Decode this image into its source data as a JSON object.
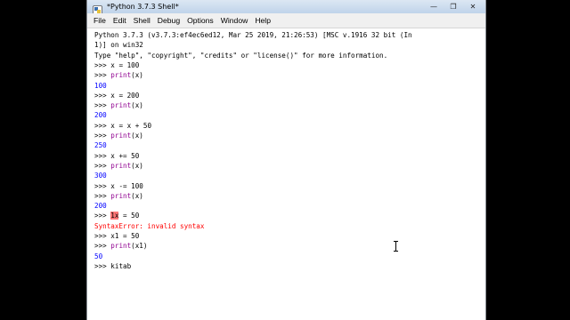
{
  "window": {
    "title": "*Python 3.7.3 Shell*",
    "min_glyph": "—",
    "max_glyph": "❐",
    "close_glyph": "✕"
  },
  "menu": [
    "File",
    "Edit",
    "Shell",
    "Debug",
    "Options",
    "Window",
    "Help"
  ],
  "banner": [
    "Python 3.7.3 (v3.7.3:ef4ec6ed12, Mar 25 2019, 21:26:53) [MSC v.1916 32 bit (In",
    "1)] on win32",
    "Type \"help\", \"copyright\", \"credits\" or \"license()\" for more information."
  ],
  "prompt": ">>> ",
  "session": [
    {
      "kind": "input",
      "text": "x = 100"
    },
    {
      "kind": "call",
      "fn": "print",
      "args": "(x)"
    },
    {
      "kind": "output",
      "text": "100"
    },
    {
      "kind": "input",
      "text": "x = 200"
    },
    {
      "kind": "call",
      "fn": "print",
      "args": "(x)"
    },
    {
      "kind": "output",
      "text": "200"
    },
    {
      "kind": "input",
      "text": "x = x + 50"
    },
    {
      "kind": "call",
      "fn": "print",
      "args": "(x)"
    },
    {
      "kind": "output",
      "text": "250"
    },
    {
      "kind": "input",
      "text": "x += 50"
    },
    {
      "kind": "call",
      "fn": "print",
      "args": "(x)"
    },
    {
      "kind": "output",
      "text": "300"
    },
    {
      "kind": "input",
      "text": "x -= 100"
    },
    {
      "kind": "call",
      "fn": "print",
      "args": "(x)"
    },
    {
      "kind": "output",
      "text": "200"
    },
    {
      "kind": "error_input",
      "marked": "1x",
      "rest": " = 50"
    },
    {
      "kind": "error",
      "text": "SyntaxError: invalid syntax"
    },
    {
      "kind": "input",
      "text": "x1 = 50"
    },
    {
      "kind": "call",
      "fn": "print",
      "args": "(x1)"
    },
    {
      "kind": "output",
      "text": "50"
    },
    {
      "kind": "input",
      "text": "kitab"
    }
  ],
  "colors": {
    "keyword": "#900090",
    "output": "#0000ff",
    "error": "#ff0000",
    "error_highlight": "#ff7777"
  },
  "icons": {
    "app": "python-idle-icon",
    "pointer": "ibeam-cursor-icon"
  }
}
